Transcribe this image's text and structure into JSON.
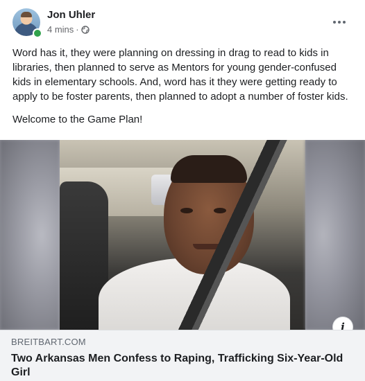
{
  "post": {
    "author": "Jon Uhler",
    "time": "4 mins",
    "separator": "·",
    "privacy_icon": "globe-icon",
    "more_icon": "more-options-icon",
    "text_paragraph_1": "Word has it, they were planning on dressing in drag to read to kids in libraries, then planned to serve as Mentors for young gender-confused kids in elementary schools.  And, word has it they were getting ready to apply to be foster parents, then planned to adopt a number of foster kids.",
    "text_paragraph_2": "Welcome to the Game Plan!"
  },
  "link": {
    "domain": "BREITBART.COM",
    "title": "Two Arkansas Men Confess to Raping, Trafficking Six-Year-Old Girl",
    "info_label": "i"
  },
  "colors": {
    "online_status": "#31a24c",
    "meta_text": "#65676b",
    "link_background": "#f2f3f5"
  }
}
